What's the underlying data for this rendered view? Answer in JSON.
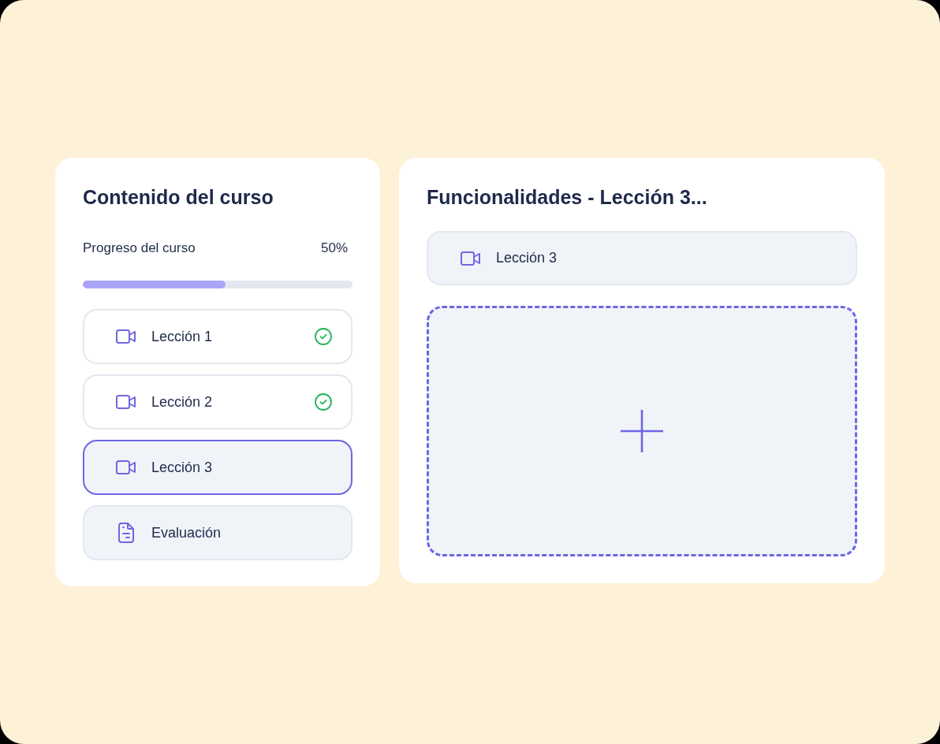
{
  "course_panel": {
    "title": "Contenido del curso",
    "progress": {
      "label": "Progreso del curso",
      "value": "50%",
      "level": 0.53
    },
    "items": [
      {
        "kind": "video",
        "label": "Lección 1",
        "completed": true,
        "selected": false
      },
      {
        "kind": "video",
        "label": "Lección 2",
        "completed": true,
        "selected": false
      },
      {
        "kind": "video",
        "label": "Lección 3",
        "completed": false,
        "selected": true
      },
      {
        "kind": "document",
        "label": "Evaluación",
        "completed": false,
        "selected": false
      }
    ]
  },
  "detail_panel": {
    "title": "Funcionalidades - Lección 3...",
    "lesson": {
      "kind": "video",
      "label": "Lección 3"
    }
  }
}
